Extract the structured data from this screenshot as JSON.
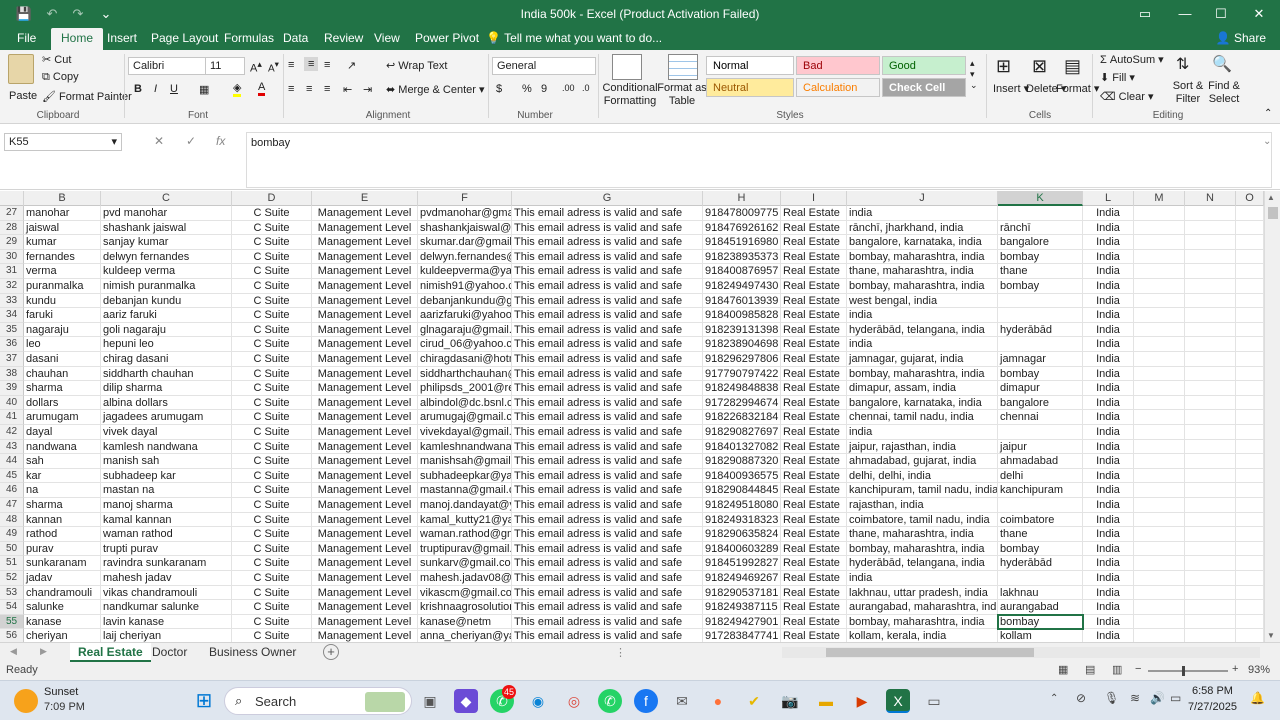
{
  "window": {
    "title": "India 500k - Excel (Product Activation Failed)"
  },
  "quick_access": {
    "save": "💾",
    "undo": "↶",
    "redo": "↷",
    "more": "⌄"
  },
  "window_controls": {
    "ribbon_display": "▭",
    "minimize": "—",
    "maximize": "☐",
    "close": "✕"
  },
  "menu_tabs": [
    "File",
    "Home",
    "Insert",
    "Page Layout",
    "Formulas",
    "Data",
    "Review",
    "View",
    "Power Pivot"
  ],
  "tell_me": "Tell me what you want to do...",
  "share": "Share",
  "ribbon": {
    "clipboard": {
      "paste": "Paste",
      "cut": "Cut",
      "copy": "Copy",
      "format_painter": "Format Painter",
      "label": "Clipboard"
    },
    "font": {
      "name": "Calibri",
      "size": "11",
      "label": "Font",
      "bold": "B",
      "italic": "I",
      "underline": "U"
    },
    "alignment": {
      "wrap_text": "Wrap Text",
      "merge_center": "Merge & Center",
      "label": "Alignment"
    },
    "number": {
      "format": "General",
      "label": "Number",
      "currency": "$",
      "percent": "%",
      "comma": "9"
    },
    "styles": {
      "conditional": "Conditional Formatting",
      "format_table": "Format as Table",
      "label": "Styles",
      "cells": [
        {
          "name": "Normal",
          "bg": "#ffffff",
          "fg": "#000000"
        },
        {
          "name": "Bad",
          "bg": "#ffc7ce",
          "fg": "#9c0006"
        },
        {
          "name": "Good",
          "bg": "#c6efce",
          "fg": "#006100"
        },
        {
          "name": "Neutral",
          "bg": "#ffeb9c",
          "fg": "#9c5700"
        },
        {
          "name": "Calculation",
          "bg": "#f2f2f2",
          "fg": "#fa7d00"
        },
        {
          "name": "Check Cell",
          "bg": "#a5a5a5",
          "fg": "#ffffff"
        }
      ]
    },
    "cells": {
      "insert": "Insert",
      "delete": "Delete",
      "format": "Format",
      "label": "Cells"
    },
    "editing": {
      "autosum": "AutoSum",
      "fill": "Fill",
      "clear": "Clear",
      "sort_filter": "Sort & Filter",
      "find_select": "Find & Select",
      "label": "Editing"
    }
  },
  "formula_bar": {
    "name_box": "K55",
    "value": "bombay"
  },
  "columns": [
    "B",
    "C",
    "D",
    "E",
    "F",
    "G",
    "H",
    "I",
    "J",
    "K",
    "L",
    "M",
    "N",
    "O"
  ],
  "rows": [
    {
      "n": "27",
      "B": "manohar",
      "C": "pvd manohar",
      "D": "C Suite",
      "E": "Management Level",
      "F": "pvdmanohar@gmai",
      "G": "This email adress is valid and safe",
      "H": "918478009775",
      "I": "Real Estate",
      "J": "india",
      "K": "",
      "L": "India"
    },
    {
      "n": "28",
      "B": "jaiswal",
      "C": "shashank jaiswal",
      "D": "C Suite",
      "E": "Management Level",
      "F": "shashankjaiswal@g",
      "G": "This email adress is valid and safe",
      "H": "918476926162",
      "I": "Real Estate",
      "J": "rānchī, jharkhand, india",
      "K": "rānchī",
      "L": "India"
    },
    {
      "n": "29",
      "B": "kumar",
      "C": "sanjay kumar",
      "D": "C Suite",
      "E": "Management Level",
      "F": "skumar.dar@gmail.",
      "G": "This email adress is valid and safe",
      "H": "918451916980",
      "I": "Real Estate",
      "J": "bangalore, karnataka, india",
      "K": "bangalore",
      "L": "India"
    },
    {
      "n": "30",
      "B": "fernandes",
      "C": "delwyn fernandes",
      "D": "C Suite",
      "E": "Management Level",
      "F": "delwyn.fernandes@",
      "G": "This email adress is valid and safe",
      "H": "918238935373",
      "I": "Real Estate",
      "J": "bombay, maharashtra, india",
      "K": "bombay",
      "L": "India"
    },
    {
      "n": "31",
      "B": "verma",
      "C": "kuldeep verma",
      "D": "C Suite",
      "E": "Management Level",
      "F": "kuldeepverma@yah",
      "G": "This email adress is valid and safe",
      "H": "918400876957",
      "I": "Real Estate",
      "J": "thane, maharashtra, india",
      "K": "thane",
      "L": "India"
    },
    {
      "n": "32",
      "B": "puranmalka",
      "C": "nimish puranmalka",
      "D": "C Suite",
      "E": "Management Level",
      "F": "nimish91@yahoo.c",
      "G": "This email adress is valid and safe",
      "H": "918249497430",
      "I": "Real Estate",
      "J": "bombay, maharashtra, india",
      "K": "bombay",
      "L": "India"
    },
    {
      "n": "33",
      "B": "kundu",
      "C": "debanjan kundu",
      "D": "C Suite",
      "E": "Management Level",
      "F": "debanjankundu@gr",
      "G": "This email adress is valid and safe",
      "H": "918476013939",
      "I": "Real Estate",
      "J": "west bengal, india",
      "K": "",
      "L": "India"
    },
    {
      "n": "34",
      "B": "faruki",
      "C": "aariz faruki",
      "D": "C Suite",
      "E": "Management Level",
      "F": "aarizfaruki@yahoo.",
      "G": "This email adress is valid and safe",
      "H": "918400985828",
      "I": "Real Estate",
      "J": "india",
      "K": "",
      "L": "India"
    },
    {
      "n": "35",
      "B": "nagaraju",
      "C": "goli nagaraju",
      "D": "C Suite",
      "E": "Management Level",
      "F": "glnagaraju@gmail.c",
      "G": "This email adress is valid and safe",
      "H": "918239131398",
      "I": "Real Estate",
      "J": "hyderābād, telangana, india",
      "K": "hyderābād",
      "L": "India"
    },
    {
      "n": "36",
      "B": "leo",
      "C": "hepuni leo",
      "D": "C Suite",
      "E": "Management Level",
      "F": "cirud_06@yahoo.co",
      "G": "This email adress is valid and safe",
      "H": "918238904698",
      "I": "Real Estate",
      "J": "india",
      "K": "",
      "L": "India"
    },
    {
      "n": "37",
      "B": "dasani",
      "C": "chirag dasani",
      "D": "C Suite",
      "E": "Management Level",
      "F": "chiragdasani@hotm",
      "G": "This email adress is valid and safe",
      "H": "918296297806",
      "I": "Real Estate",
      "J": "jamnagar, gujarat, india",
      "K": "jamnagar",
      "L": "India"
    },
    {
      "n": "38",
      "B": "chauhan",
      "C": "siddharth chauhan",
      "D": "C Suite",
      "E": "Management Level",
      "F": "siddharthchauhan@",
      "G": "This email adress is valid and safe",
      "H": "917790797422",
      "I": "Real Estate",
      "J": "bombay, maharashtra, india",
      "K": "bombay",
      "L": "India"
    },
    {
      "n": "39",
      "B": "sharma",
      "C": "dilip sharma",
      "D": "C Suite",
      "E": "Management Level",
      "F": "philipsds_2001@re",
      "G": "This email adress is valid and safe",
      "H": "918249848838",
      "I": "Real Estate",
      "J": "dimapur, assam, india",
      "K": "dimapur",
      "L": "India"
    },
    {
      "n": "40",
      "B": "dollars",
      "C": "albina dollars",
      "D": "C Suite",
      "E": "Management Level",
      "F": "albindol@dc.bsnl.co",
      "G": "This email adress is valid and safe",
      "H": "917282994674",
      "I": "Real Estate",
      "J": "bangalore, karnataka, india",
      "K": "bangalore",
      "L": "India"
    },
    {
      "n": "41",
      "B": "arumugam",
      "C": "jagadees arumugam",
      "D": "C Suite",
      "E": "Management Level",
      "F": "arumugaj@gmail.co",
      "G": "This email adress is valid and safe",
      "H": "918226832184",
      "I": "Real Estate",
      "J": "chennai, tamil nadu, india",
      "K": "chennai",
      "L": "India"
    },
    {
      "n": "42",
      "B": "dayal",
      "C": "vivek dayal",
      "D": "C Suite",
      "E": "Management Level",
      "F": "vivekdayal@gmail.c",
      "G": "This email adress is valid and safe",
      "H": "918290827697",
      "I": "Real Estate",
      "J": "india",
      "K": "",
      "L": "India"
    },
    {
      "n": "43",
      "B": "nandwana",
      "C": "kamlesh nandwana",
      "D": "C Suite",
      "E": "Management Level",
      "F": "kamleshnandwana@",
      "G": "This email adress is valid and safe",
      "H": "918401327082",
      "I": "Real Estate",
      "J": "jaipur, rajasthan, india",
      "K": "jaipur",
      "L": "India"
    },
    {
      "n": "44",
      "B": "sah",
      "C": "manish sah",
      "D": "C Suite",
      "E": "Management Level",
      "F": "manishsah@gmail.c",
      "G": "This email adress is valid and safe",
      "H": "918290887320",
      "I": "Real Estate",
      "J": "ahmadabad, gujarat, india",
      "K": "ahmadabad",
      "L": "India"
    },
    {
      "n": "45",
      "B": "kar",
      "C": "subhadeep kar",
      "D": "C Suite",
      "E": "Management Level",
      "F": "subhadeepkar@yah",
      "G": "This email adress is valid and safe",
      "H": "918400936575",
      "I": "Real Estate",
      "J": "delhi, delhi, india",
      "K": "delhi",
      "L": "India"
    },
    {
      "n": "46",
      "B": "na",
      "C": "mastan na",
      "D": "C Suite",
      "E": "Management Level",
      "F": "mastanna@gmail.co",
      "G": "This email adress is valid and safe",
      "H": "918290844845",
      "I": "Real Estate",
      "J": "kanchipuram, tamil nadu, india",
      "K": "kanchipuram",
      "L": "India"
    },
    {
      "n": "47",
      "B": "sharma",
      "C": "manoj sharma",
      "D": "C Suite",
      "E": "Management Level",
      "F": "manoj.dandayat@y",
      "G": "This email adress is valid and safe",
      "H": "918249518080",
      "I": "Real Estate",
      "J": "rajasthan, india",
      "K": "",
      "L": "India"
    },
    {
      "n": "48",
      "B": "kannan",
      "C": "kamal kannan",
      "D": "C Suite",
      "E": "Management Level",
      "F": "kamal_kutty21@ya",
      "G": "This email adress is valid and safe",
      "H": "918249318323",
      "I": "Real Estate",
      "J": "coimbatore, tamil nadu, india",
      "K": "coimbatore",
      "L": "India"
    },
    {
      "n": "49",
      "B": "rathod",
      "C": "waman rathod",
      "D": "C Suite",
      "E": "Management Level",
      "F": "waman.rathod@gm",
      "G": "This email adress is valid and safe",
      "H": "918290635824",
      "I": "Real Estate",
      "J": "thane, maharashtra, india",
      "K": "thane",
      "L": "India"
    },
    {
      "n": "50",
      "B": "purav",
      "C": "trupti purav",
      "D": "C Suite",
      "E": "Management Level",
      "F": "truptipurav@gmail.",
      "G": "This email adress is valid and safe",
      "H": "918400603289",
      "I": "Real Estate",
      "J": "bombay, maharashtra, india",
      "K": "bombay",
      "L": "India"
    },
    {
      "n": "51",
      "B": "sunkaranam",
      "C": "ravindra sunkaranam",
      "D": "C Suite",
      "E": "Management Level",
      "F": "sunkarv@gmail.com",
      "G": "This email adress is valid and safe",
      "H": "918451992827",
      "I": "Real Estate",
      "J": "hyderābād, telangana, india",
      "K": "hyderābād",
      "L": "India"
    },
    {
      "n": "52",
      "B": "jadav",
      "C": "mahesh jadav",
      "D": "C Suite",
      "E": "Management Level",
      "F": "mahesh.jadav08@y",
      "G": "This email adress is valid and safe",
      "H": "918249469267",
      "I": "Real Estate",
      "J": "india",
      "K": "",
      "L": "India"
    },
    {
      "n": "53",
      "B": "chandramouli",
      "C": "vikas chandramouli",
      "D": "C Suite",
      "E": "Management Level",
      "F": "vikascm@gmail.con",
      "G": "This email adress is valid and safe",
      "H": "918290537181",
      "I": "Real Estate",
      "J": "lakhnau, uttar pradesh, india",
      "K": "lakhnau",
      "L": "India"
    },
    {
      "n": "54",
      "B": "salunke",
      "C": "nandkumar salunke",
      "D": "C Suite",
      "E": "Management Level",
      "F": "krishnaagrosolution",
      "G": "This email adress is valid and safe",
      "H": "918249387115",
      "I": "Real Estate",
      "J": "aurangabad, maharashtra, india",
      "K": "aurangabad",
      "L": "India"
    },
    {
      "n": "55",
      "B": "kanase",
      "C": "lavin kanase",
      "D": "C Suite",
      "E": "Management Level",
      "F": "kanase@netm",
      "G": "This email adress is valid and safe",
      "H": "918249427901",
      "I": "Real Estate",
      "J": "bombay, maharashtra, india",
      "K": "bombay",
      "L": "India"
    },
    {
      "n": "56",
      "B": "cheriyan",
      "C": "laij cheriyan",
      "D": "C Suite",
      "E": "Management Level",
      "F": "anna_cheriyan@yal",
      "G": "This email adress is valid and safe",
      "H": "917283847741",
      "I": "Real Estate",
      "J": "kollam, kerala, india",
      "K": "kollam",
      "L": "India"
    }
  ],
  "sheets": [
    "Real Estate",
    "Doctor",
    "Business Owner"
  ],
  "status": {
    "ready": "Ready",
    "zoom": "93%"
  },
  "taskbar": {
    "weather_title": "Sunset",
    "weather_time": "7:09 PM",
    "search": "Search",
    "time": "6:58 PM",
    "date": "7/27/2025",
    "badge": "45"
  },
  "colors": {
    "excel_green": "#217346",
    "selection": "#217346"
  }
}
